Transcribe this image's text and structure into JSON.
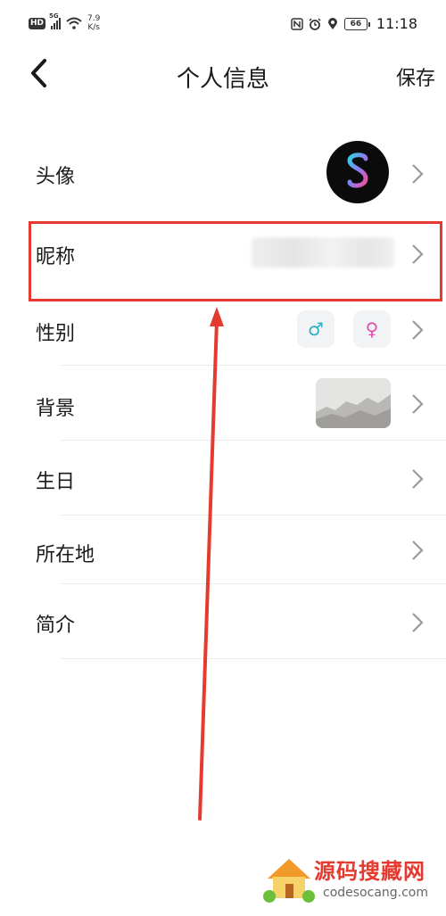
{
  "status_bar": {
    "hd": "HD",
    "network": "5G",
    "speed_value": "7.9",
    "speed_unit": "K/s",
    "battery": "66",
    "time": "11:18",
    "icons": [
      "nfc-icon",
      "alarm-icon",
      "location-icon"
    ]
  },
  "header": {
    "title": "个人信息",
    "save_label": "保存",
    "back_icon": "chevron-left-icon"
  },
  "rows": [
    {
      "label": "头像"
    },
    {
      "label": "昵称"
    },
    {
      "label": "性别"
    },
    {
      "label": "背景"
    },
    {
      "label": "生日"
    },
    {
      "label": "所在地"
    },
    {
      "label": "简介"
    }
  ],
  "gender": {
    "male_symbol": "♂",
    "female_symbol": "♀",
    "male_color": "#2bb0c4",
    "female_color": "#e04fb0"
  },
  "annotation": {
    "highlight_color": "#e53a30"
  },
  "watermark": {
    "title": "源码搜藏网",
    "subtitle": "codesocang.com"
  }
}
